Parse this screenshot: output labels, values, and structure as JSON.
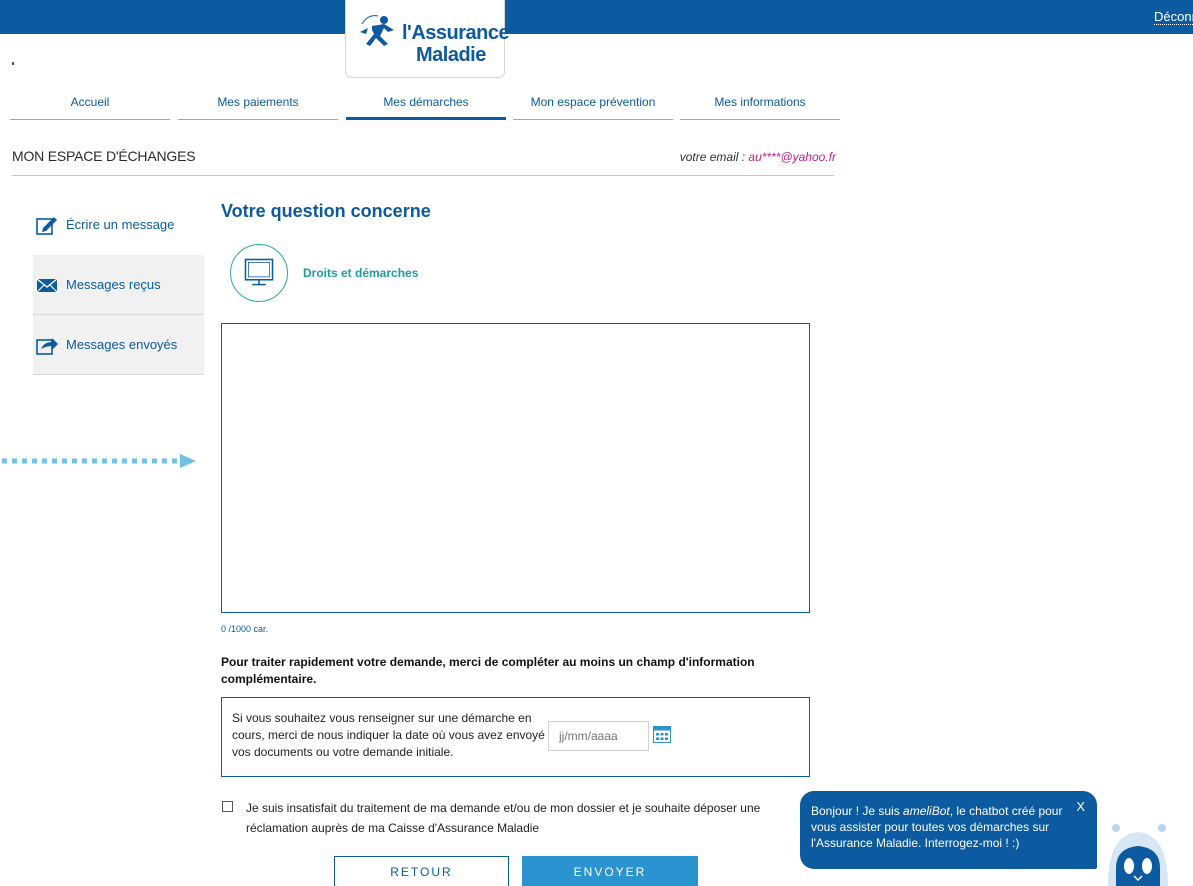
{
  "header": {
    "logout_label": "Déconnexion",
    "logo_line1": "l'Assurance",
    "logo_line2": "Maladie"
  },
  "nav": {
    "items": [
      {
        "label": "Accueil",
        "active": false
      },
      {
        "label": "Mes paiements",
        "active": false
      },
      {
        "label": "Mes démarches",
        "active": true
      },
      {
        "label": "Mon espace prévention",
        "active": false
      },
      {
        "label": "Mes informations",
        "active": false
      }
    ]
  },
  "section": {
    "title": "MON ESPACE D'ÉCHANGES",
    "email_label": "votre email : ",
    "email_value": "au****@yahoo.fr"
  },
  "sidebar": {
    "items": [
      {
        "label": "Écrire un message",
        "icon": "pencil-icon"
      },
      {
        "label": "Messages reçus",
        "icon": "envelope-icon"
      },
      {
        "label": "Messages envoyés",
        "icon": "sent-icon"
      }
    ]
  },
  "main": {
    "question_title": "Votre question concerne",
    "topic_label": "Droits et démarches",
    "topic_icon": "monitor-icon",
    "message_value": "",
    "counter": "0 /1000 car.",
    "info_text": "Pour traiter rapidement votre demande, merci de compléter au moins un champ d'information complémentaire.",
    "date_description": "Si vous souhaitez vous renseigner sur une démarche en cours, merci de nous indiquer la date où vous avez envoyé vos documents ou votre demande initiale.",
    "date_placeholder": "jj/mm/aaaa",
    "complaint_label": "Je suis insatisfait du traitement de ma demande et/ou de mon dossier et je souhaite déposer une réclamation auprès de ma Caisse d'Assurance Maladie",
    "back_label": "RETOUR",
    "send_label": "ENVOYER"
  },
  "chatbot": {
    "text_before": "Bonjour ! Je suis ",
    "bot_name": "ameliBot",
    "text_after": ", le chatbot créé pour vous assister pour toutes vos démarches sur l'Assurance Maladie. Interrogez-moi ! :)",
    "close_label": "X"
  },
  "colors": {
    "primary": "#0c5aa0",
    "accent_teal": "#1f9c9c",
    "button_blue": "#2b93d0",
    "email_pink": "#c0208a"
  }
}
